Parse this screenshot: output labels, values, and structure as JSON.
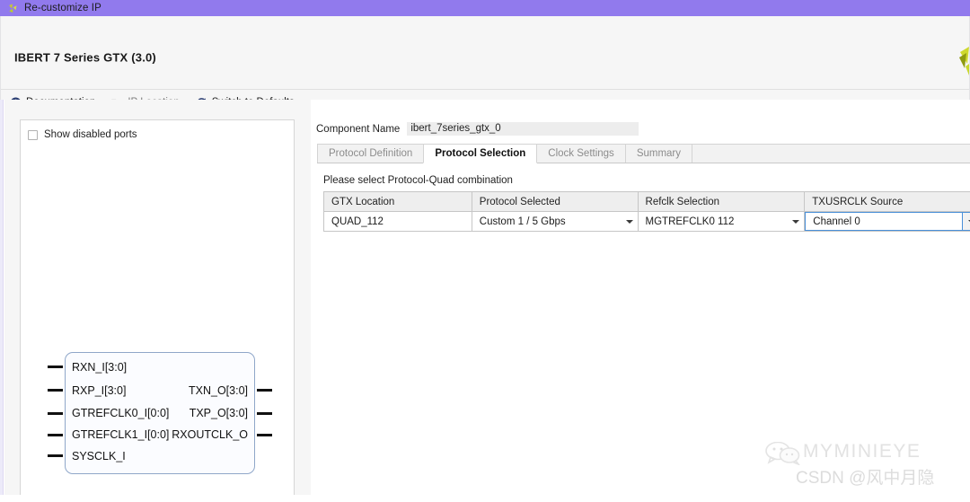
{
  "window": {
    "title": "Re-customize IP",
    "title_icon": "xilinx-logo-icon",
    "titlebar_color": "#917aed"
  },
  "header": {
    "title": "IBERT 7 Series GTX (3.0)",
    "logo_icon": "xilinx-logo-icon",
    "toolbar": [
      {
        "label": "Documentation",
        "icon": "info-icon",
        "enabled": true
      },
      {
        "label": "IP Location",
        "icon": "folder-icon",
        "enabled": false
      },
      {
        "label": "Switch to Defaults",
        "icon": "refresh-icon",
        "enabled": true
      }
    ]
  },
  "left_pane": {
    "show_disabled_ports": {
      "label": "Show disabled ports",
      "checked": false
    },
    "symbol": {
      "inputs": [
        "RXN_I[3:0]",
        "RXP_I[3:0]",
        "GTREFCLK0_I[0:0]",
        "GTREFCLK1_I[0:0]",
        "SYSCLK_I"
      ],
      "outputs": [
        "TXN_O[3:0]",
        "TXP_O[3:0]",
        "RXOUTCLK_O"
      ]
    }
  },
  "right_pane": {
    "component_name": {
      "label": "Component Name",
      "value": "ibert_7series_gtx_0"
    },
    "tabs": [
      {
        "label": "Protocol Definition",
        "active": false
      },
      {
        "label": "Protocol Selection",
        "active": true
      },
      {
        "label": "Clock Settings",
        "active": false
      },
      {
        "label": "Summary",
        "active": false
      }
    ],
    "hint": "Please select Protocol-Quad combination",
    "table": {
      "columns": [
        "GTX Location",
        "Protocol Selected",
        "Refclk Selection",
        "TXUSRCLK Source"
      ],
      "rows": [
        {
          "gtx_location": "QUAD_112",
          "protocol_selected": "Custom 1 / 5 Gbps",
          "refclk_selection": "MGTREFCLK0 112",
          "txusrclk_source": "Channel 0"
        }
      ]
    }
  },
  "watermark": {
    "line1": "MYMINIEYE",
    "line2": "CSDN @风中月隐",
    "icon": "wechat-icon"
  }
}
